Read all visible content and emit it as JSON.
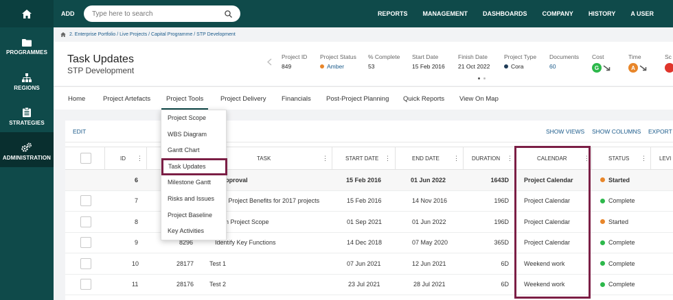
{
  "sidebar": {
    "items": [
      {
        "label": "PROGRAMMES",
        "icon": "folder-icon"
      },
      {
        "label": "REGIONS",
        "icon": "org-chart-icon"
      },
      {
        "label": "STRATEGIES",
        "icon": "clipboard-icon"
      },
      {
        "label": "ADMINISTRATION",
        "icon": "gears-icon"
      }
    ]
  },
  "topbar": {
    "add_label": "ADD",
    "search_placeholder": "Type here to search",
    "nav": [
      "REPORTS",
      "MANAGEMENT",
      "DASHBOARDS",
      "COMPANY",
      "HISTORY",
      "A USER"
    ]
  },
  "breadcrumb": "2. Enterprise Portfolio / Live Projects / Capital Programme / STP Development",
  "header": {
    "title": "Task Updates",
    "subtitle": "STP Development",
    "stats": [
      {
        "key": "Project ID",
        "value": "849"
      },
      {
        "key": "Project Status",
        "value": "Amber",
        "dot": "#e8862a"
      },
      {
        "key": "% Complete",
        "value": "53"
      },
      {
        "key": "Start Date",
        "value": "15 Feb 2016"
      },
      {
        "key": "Finish Date",
        "value": "21 Oct 2022"
      },
      {
        "key": "Project Type",
        "value": "Cora",
        "dot": "#1f3b57"
      },
      {
        "key": "Documents",
        "value": "60"
      },
      {
        "key": "Cost",
        "badge": "G",
        "badge_color": "#2db84b"
      },
      {
        "key": "Time",
        "badge": "A",
        "badge_color": "#e8862a"
      },
      {
        "key": "Sc"
      }
    ]
  },
  "tabs": [
    "Home",
    "Project Artefacts",
    "Project Tools",
    "Project Delivery",
    "Financials",
    "Post-Project Planning",
    "Quick Reports",
    "View On Map"
  ],
  "dropdown": [
    "Project Scope",
    "WBS Diagram",
    "Gantt Chart",
    "Task Updates",
    "Milestone Gantt",
    "Risks and Issues",
    "Project Baseline",
    "Key Activities"
  ],
  "toolbar": {
    "edit": "EDIT",
    "show_views": "SHOW VIEWS",
    "show_columns": "SHOW COLUMNS",
    "export": "EXPORT"
  },
  "table": {
    "columns": [
      "ID",
      "TASK",
      "START DATE",
      "END DATE",
      "DURATION",
      "CALENDAR",
      "STATUS",
      "LEVI"
    ],
    "rows": [
      {
        "id": "6",
        "ref": "",
        "task": "tive Approval",
        "start": "15 Feb 2016",
        "end": "01 Jun 2022",
        "duration": "1643D",
        "calendar": "Project Calendar",
        "status": "Started",
        "bold": true,
        "checkbox": false
      },
      {
        "id": "7",
        "ref": "",
        "task": "ine Project Benefits for 2017 projects",
        "start": "15 Feb 2016",
        "end": "14 Nov 2016",
        "duration": "196D",
        "calendar": "Project Calendar",
        "status": "Complete",
        "checkbox": true
      },
      {
        "id": "8",
        "ref": "",
        "task": "firm Project Scope",
        "start": "01 Sep 2021",
        "end": "01 Jun 2022",
        "duration": "196D",
        "calendar": "Project Calendar",
        "status": "Started",
        "checkbox": true
      },
      {
        "id": "9",
        "ref": "8296",
        "task": "Identify Key Functions",
        "start": "14 Dec 2018",
        "end": "07 May 2020",
        "duration": "365D",
        "calendar": "Project Calendar",
        "status": "Complete",
        "checkbox": true
      },
      {
        "id": "10",
        "ref": "28177",
        "task": "Test 1",
        "start": "07 Jun 2021",
        "end": "12 Jun 2021",
        "duration": "6D",
        "calendar": "Weekend work",
        "status": "Complete",
        "checkbox": true
      },
      {
        "id": "11",
        "ref": "28176",
        "task": "Test 2",
        "start": "23 Jul 2021",
        "end": "28 Jul 2021",
        "duration": "6D",
        "calendar": "Weekend work",
        "status": "Complete",
        "checkbox": true
      }
    ]
  },
  "colors": {
    "brand": "#0f4a4a",
    "highlight": "#7b1e45",
    "started": "#e8862a",
    "complete": "#2db84b",
    "link": "#1a5a8a"
  }
}
